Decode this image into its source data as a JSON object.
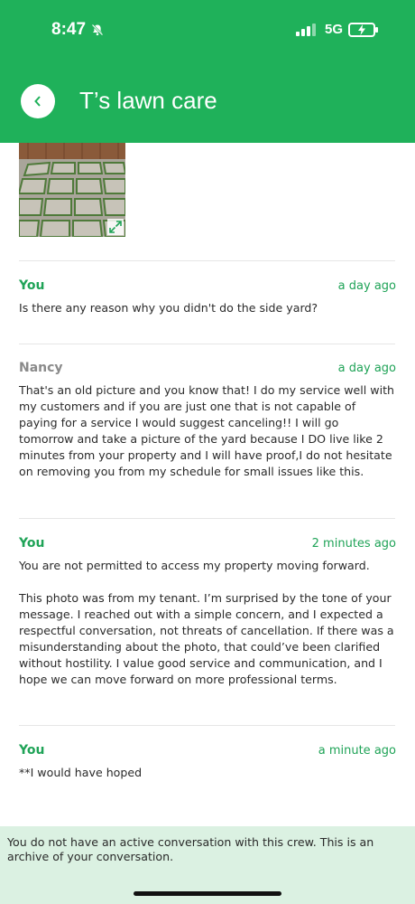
{
  "status_bar": {
    "time": "8:47",
    "network": "5G"
  },
  "header": {
    "title": "T’s lawn care"
  },
  "messages": [
    {
      "sender": "You",
      "time": "a day ago",
      "text": "Is there any reason why you didn't do the side yard?"
    },
    {
      "sender": "Nancy",
      "time": "a day ago",
      "text": "That's an old picture and you know that! I do my service well with my customers and if you are just one that is not capable of paying for a service I would suggest canceling!! I will go tomorrow and take a picture of the yard because I DO live like 2 minutes from your property and I will have proof,I do not hesitate on removing you from my schedule for small issues like this."
    },
    {
      "sender": "You",
      "time": "2 minutes ago",
      "text": "You are not permitted to access my property moving forward.\n\nThis photo was from my tenant. I’m surprised by the tone of your message. I reached out with a simple concern, and I expected a respectful conversation, not threats of cancellation. If there was a misunderstanding about the photo, that could’ve been clarified without hostility. I value good service and communication, and I hope we can move forward on more professional terms."
    },
    {
      "sender": "You",
      "time": "a minute ago",
      "text": "**I would have hoped"
    }
  ],
  "archive_notice": "You do not have an active conversation with this crew. This is an archive of your conversation.",
  "colors": {
    "brand_green": "#1fb15a",
    "accent_green": "#1fa357",
    "banner_bg": "#dbf1e2"
  }
}
